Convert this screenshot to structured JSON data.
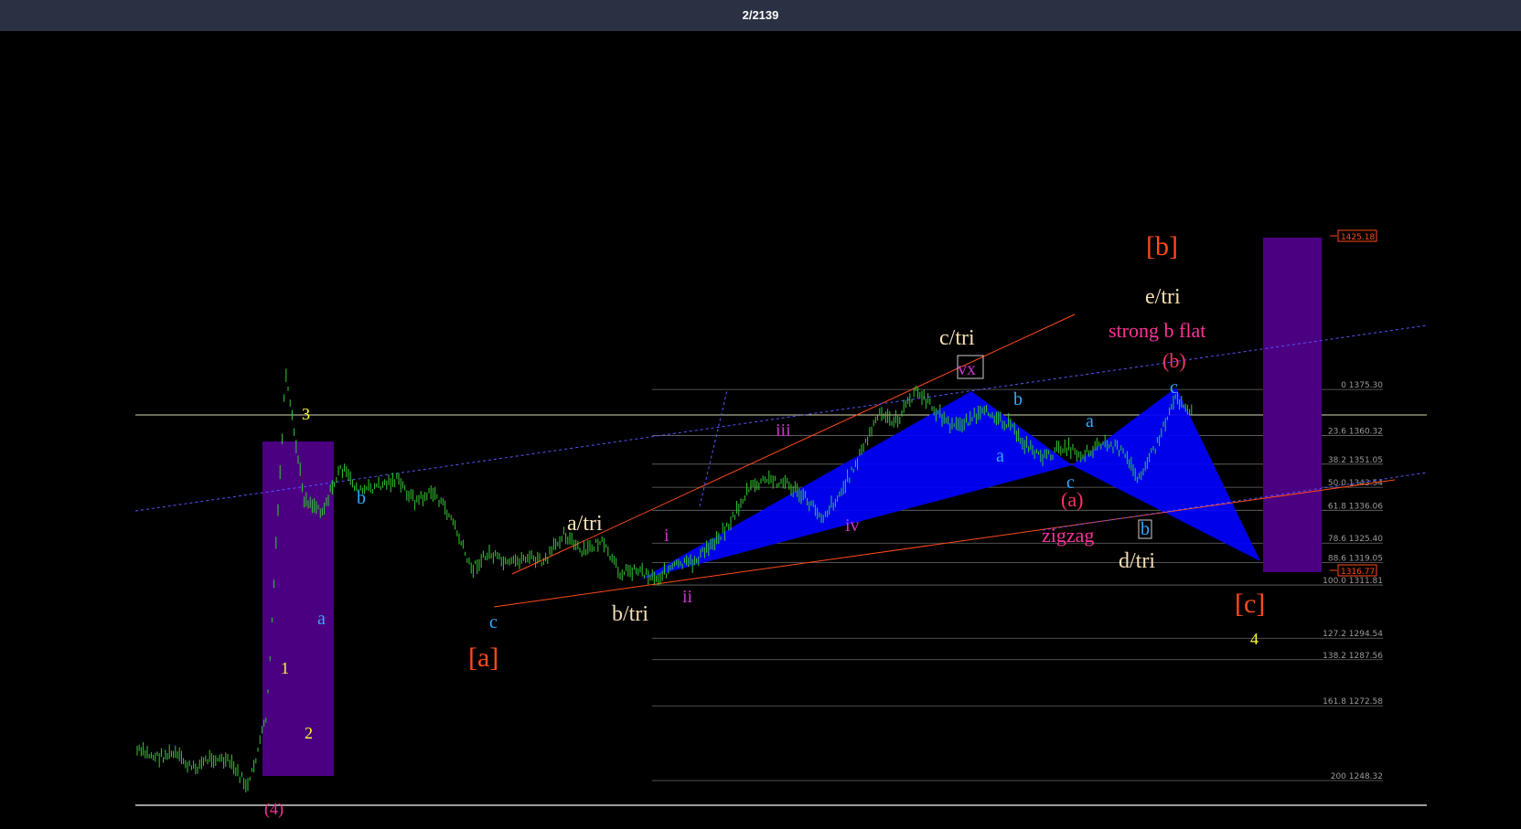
{
  "toolbar": {
    "counter": "2/2139"
  },
  "colors": {
    "background": "#000000",
    "topbar": "#2a3142",
    "candles": "#33cc33",
    "harmonic": "#0000ff",
    "box": "#4b0082",
    "trendline": "#ff4a1a",
    "channel": "#5555ff"
  },
  "labels": {
    "w3": "3",
    "w1": "1",
    "w2": "2",
    "w4": "4",
    "sb": "b",
    "sa": "a",
    "sc": "c",
    "atri": "a/tri",
    "btri": "b/tri",
    "ctri": "c/tri",
    "dtri": "d/tri",
    "etri": "e/tri",
    "ba": "[a]",
    "bb": "[b]",
    "bc": "[c]",
    "ri": "i",
    "rii": "ii",
    "riii": "iii",
    "riv": "iv",
    "rvx": "vx",
    "ta": "a",
    "tb": "b",
    "ta2": "a",
    "tc": "c",
    "ta3": "a",
    "tb2": "b",
    "tc2": "c",
    "pa": "(a)",
    "pb": "(b)",
    "zigzag": "zigzag",
    "strong": "strong b flat",
    "p4": "(4)"
  },
  "fib_levels": [
    {
      "ratio": "0",
      "price": "1375.30"
    },
    {
      "ratio": "23.6",
      "price": "1360.32"
    },
    {
      "ratio": "38.2",
      "price": "1351.05"
    },
    {
      "ratio": "50.0",
      "price": "1343.54"
    },
    {
      "ratio": "61.8",
      "price": "1336.06"
    },
    {
      "ratio": "78.6",
      "price": "1325.40"
    },
    {
      "ratio": "88.6",
      "price": "1319.05"
    },
    {
      "ratio": "100.0",
      "price": "1311.81"
    },
    {
      "ratio": "127.2",
      "price": "1294.54"
    },
    {
      "ratio": "138.2",
      "price": "1287.56"
    },
    {
      "ratio": "161.8",
      "price": "1272.58"
    },
    {
      "ratio": "200",
      "price": "1248.32"
    }
  ],
  "price_tags": {
    "upper": "1425.18",
    "lower": "1316.77"
  },
  "chart_data": {
    "type": "line",
    "title": "",
    "xlabel": "",
    "ylabel": "",
    "ylim": [
      1248.32,
      1425.18
    ],
    "grid": false,
    "series": [
      {
        "values": [
          1258,
          1256,
          1257,
          1252,
          1256,
          1254,
          1246,
          1270,
          1380,
          1340,
          1336,
          1350,
          1342,
          1344,
          1346,
          1339,
          1342,
          1333,
          1317,
          1322,
          1318,
          1321,
          1319,
          1329,
          1322,
          1326,
          1316,
          1317,
          1314,
          1318,
          1319,
          1325,
          1332,
          1343,
          1346,
          1345,
          1340,
          1334,
          1342,
          1354,
          1367,
          1365,
          1375,
          1369,
          1363,
          1366,
          1368,
          1364,
          1357,
          1353,
          1357,
          1354,
          1358,
          1356,
          1347,
          1357,
          1373,
          1368
        ]
      }
    ]
  }
}
